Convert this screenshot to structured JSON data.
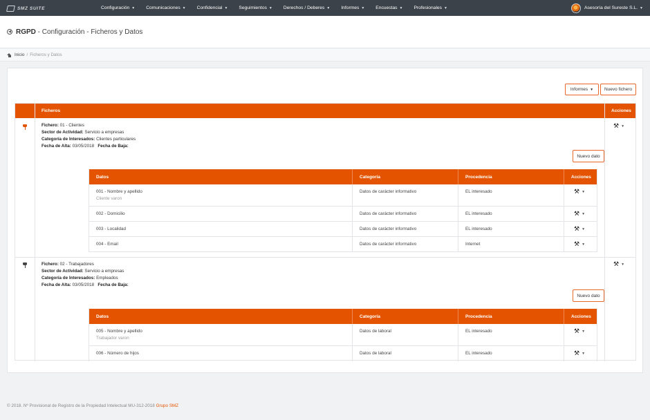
{
  "app": {
    "logo_text": "SMZ SUITE"
  },
  "nav": [
    {
      "label": "Configuración"
    },
    {
      "label": "Comunicaciones"
    },
    {
      "label": "Confidencial"
    },
    {
      "label": "Seguimientos"
    },
    {
      "label": "Derechos / Deberes"
    },
    {
      "label": "Informes"
    },
    {
      "label": "Encuestas"
    },
    {
      "label": "Profesionales"
    }
  ],
  "user": {
    "name": "Asesoría del Sureste S.L."
  },
  "page": {
    "title_bold": "RGPD",
    "title_rest": " - Configuración - Ficheros y Datos"
  },
  "breadcrumb": {
    "home": "Inicio",
    "separator": "/",
    "current": "Ficheros y Datos"
  },
  "toolbar": {
    "informes_label": "Informes",
    "nuevo_fichero_label": "Nuevo fichero"
  },
  "table": {
    "col_ficheros": "Ficheros",
    "col_acciones": "Acciones"
  },
  "labels": {
    "fichero": "Fichero:",
    "sector": "Sector de Actividad:",
    "categoria_interesados": "Categoría de Interesados:",
    "fecha_alta": "Fecha de Alta:",
    "fecha_baja": "Fecha de Baja:",
    "nuevo_dato": "Nuevo dato"
  },
  "inner_cols": {
    "datos": "Datos",
    "categoria": "Categoría",
    "procedencia": "Procedencia",
    "acciones": "Acciones"
  },
  "ficheros": [
    {
      "fichero": "01 - Clientes",
      "sector": "Servicio a empresas",
      "categoria_interesados": "Clientes particulares",
      "fecha_alta": "03/05/2018",
      "fecha_baja": "",
      "datos": [
        {
          "dato": "001 - Nombre y apellido",
          "sub": "Cliente varon",
          "categoria": "Datos de carácter informativo",
          "procedencia": "EL interesado"
        },
        {
          "dato": "002 - Domicilio",
          "sub": "",
          "categoria": "Datos de carácter informativo",
          "procedencia": "EL interesado"
        },
        {
          "dato": "003 - Localidad",
          "sub": "",
          "categoria": "Datos de carácter informativo",
          "procedencia": "EL interesado"
        },
        {
          "dato": "004 - Email",
          "sub": "",
          "categoria": "Datos de carácter informativo",
          "procedencia": "Internet"
        }
      ]
    },
    {
      "fichero": "02 - Trabajadores",
      "sector": "Servicio a empresas",
      "categoria_interesados": "Empleados",
      "fecha_alta": "03/05/2018",
      "fecha_baja": "",
      "datos": [
        {
          "dato": "005 - Nombre y apellido",
          "sub": "Trabajador varon",
          "categoria": "Datos de laboral",
          "procedencia": "EL interesado"
        },
        {
          "dato": "006 - Número de hijos",
          "sub": "",
          "categoria": "Datos de laboral",
          "procedencia": "EL interesado"
        }
      ]
    }
  ],
  "footer": {
    "text": "© 2018. Nº Provisional de Registro de la Propiedad Intelectual MU-312-2018 ",
    "link": "Grupo SMZ"
  },
  "colors": {
    "accent": "#e45400",
    "topbar": "#3b4249"
  }
}
